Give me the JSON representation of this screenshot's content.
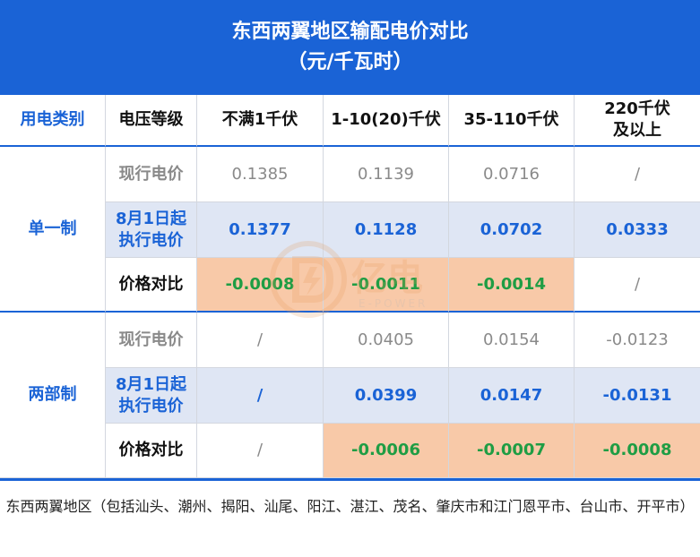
{
  "header": {
    "title_line1": "东西两翼地区输配电价对比",
    "title_line2": "（元/千瓦时）"
  },
  "table": {
    "columns": [
      "用电类别",
      "电压等级",
      "不满1千伏",
      "1-10(20)千伏",
      "35-110千伏",
      "220千伏\n及以上"
    ],
    "groups": [
      {
        "category": "单一制",
        "rows": [
          {
            "label": "现行电价",
            "values": [
              "0.1385",
              "0.1139",
              "0.0716",
              "/"
            ]
          },
          {
            "label": "8月1日起\n执行电价",
            "values": [
              "0.1377",
              "0.1128",
              "0.0702",
              "0.0333"
            ]
          },
          {
            "label": "价格对比",
            "values": [
              "-0.0008",
              "-0.0011",
              "-0.0014",
              "/"
            ]
          }
        ]
      },
      {
        "category": "两部制",
        "rows": [
          {
            "label": "现行电价",
            "values": [
              "/",
              "0.0405",
              "0.0154",
              "-0.0123"
            ]
          },
          {
            "label": "8月1日起\n执行电价",
            "values": [
              "/",
              "0.0399",
              "0.0147",
              "-0.0131"
            ]
          },
          {
            "label": "价格对比",
            "values": [
              "/",
              "-0.0006",
              "-0.0007",
              "-0.0008"
            ]
          }
        ]
      }
    ]
  },
  "watermark": {
    "name": "亿电",
    "sub": "E-POWER",
    "icon": "e-power-logo-icon"
  },
  "footer": {
    "note": "东西两翼地区（包括汕头、潮州、揭阳、汕尾、阳江、湛江、茂名、肇庆市和江门恩平市、台山市、开平市）"
  },
  "colors": {
    "header_bg": "#1a63d6",
    "accent_blue": "#1a63d6",
    "row_highlight": "#dfe6f4",
    "diff_highlight": "#f8c9a8",
    "diff_text": "#1f9d44",
    "muted_text": "#8a8a8a"
  }
}
